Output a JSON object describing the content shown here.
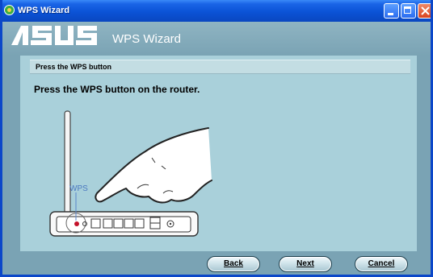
{
  "window": {
    "title": "WPS Wizard"
  },
  "header": {
    "brand": "ASUS",
    "title": "WPS Wizard"
  },
  "step": {
    "label": "Press the WPS button",
    "instruction": "Press the WPS button on the router."
  },
  "illustration": {
    "button_label": "WPS"
  },
  "buttons": {
    "back": "Back",
    "next": "Next",
    "cancel": "Cancel"
  },
  "colors": {
    "titlebar": "#0b53d6",
    "background": "#7aa3b4",
    "content_panel": "#a9d0da",
    "step_bar": "#c3dde3"
  }
}
